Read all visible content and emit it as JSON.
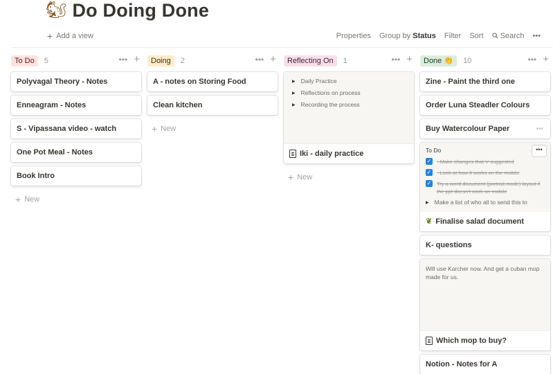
{
  "page": {
    "emoji": "🐿",
    "title": "Do Doing Done"
  },
  "viewbar": {
    "add_view": "Add a view",
    "properties": "Properties",
    "group_by": "Group by",
    "group_by_value": "Status",
    "filter": "Filter",
    "sort": "Sort",
    "search": "Search",
    "more": "•••"
  },
  "columns": [
    {
      "name": "To Do",
      "count": "5",
      "pill_bg": "#ffe2dd",
      "pill_fg": "#5d1715",
      "cards": [
        {
          "title": "Polyvagal Theory - Notes"
        },
        {
          "title": "Enneagram - Notes"
        },
        {
          "title": "S - Vipassana video - watch"
        },
        {
          "title": "One Pot Meal - Notes"
        },
        {
          "title": "Book Intro"
        }
      ],
      "new_label": "New"
    },
    {
      "name": "Doing",
      "count": "2",
      "pill_bg": "#fdecc8",
      "pill_fg": "#402c1b",
      "cards": [
        {
          "title": "A - notes on Storing Food"
        },
        {
          "title": "Clean kitchen"
        }
      ],
      "new_label": "New"
    },
    {
      "name": "Reflecting On",
      "count": "1",
      "pill_bg": "#f5e0e9",
      "pill_fg": "#4c2337",
      "cards": [
        {
          "title": "Iki - daily practice",
          "preview_toggles": [
            "Daily Practice",
            "Reflections on process",
            "Recording the process"
          ]
        }
      ],
      "new_label": "New"
    },
    {
      "name": "Done",
      "badge": "👏",
      "count": "10",
      "pill_bg": "#dbeddb",
      "pill_fg": "#1c3829",
      "cards": [
        {
          "title": "Zine - Paint the third one"
        },
        {
          "title": "Order Luna Steadler Colours"
        },
        {
          "title": "Buy Watercolour Paper",
          "more": "•••"
        },
        {
          "title": "Finalise salad document",
          "icon": "sprout",
          "todo_label": "To Do",
          "todos": [
            "- Make changes that V suggested",
            "- Look at how it works on the mobile",
            "Try a word document (portrait mode) layout if the ppt doesn't work on mobile"
          ],
          "toggle_text": "Make a list of who all to send this to"
        },
        {
          "title": "K- questions"
        },
        {
          "title": "Which mop to buy?",
          "note": "Will use Karcher now. And get a cuban mop made for us."
        },
        {
          "title": "Notion - Notes for A"
        }
      ]
    }
  ]
}
